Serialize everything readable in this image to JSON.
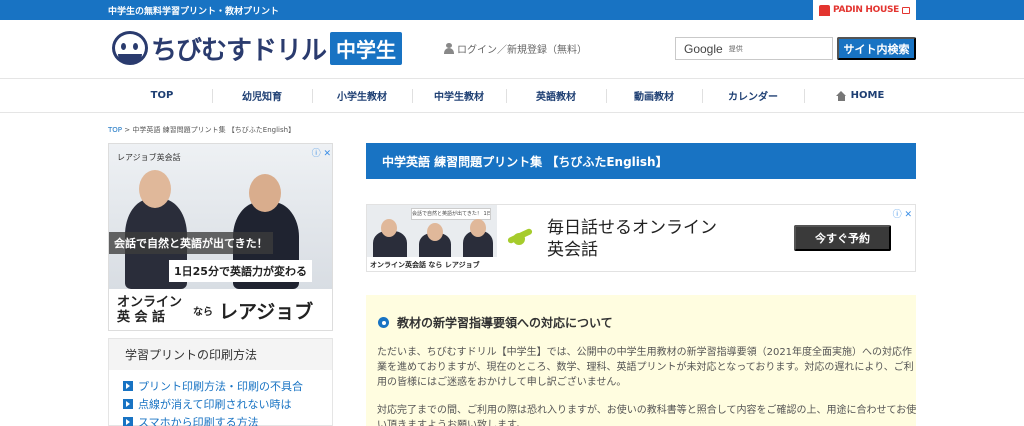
{
  "topbar": {
    "tagline": "中学生の無料学習プリント・教材プリント",
    "partner_logo": "PADIN HOUSE"
  },
  "header": {
    "logo_text": "ちびむすドリル",
    "logo_badge": "中学生",
    "login": "ログイン／新規登録（無料）",
    "search_brand": "Google",
    "search_provider": "提供",
    "search_button": "サイト内検索"
  },
  "nav": {
    "items": [
      "TOP",
      "幼児知育",
      "小学生教材",
      "中学生教材",
      "英語教材",
      "動画教材",
      "カレンダー",
      "HOME"
    ]
  },
  "breadcrumb": {
    "top": "TOP",
    "sep": " > ",
    "rest": "中学英語 練習問題プリント集 【ちびふたEnglish】"
  },
  "side_ad": {
    "brand": "レアジョブ英会話",
    "caption1": "会話で自然と英語が出てきた！",
    "caption2": "1日25分で英語力が変わる",
    "bottom1": "オンライン\n英 会 話",
    "bottom2": "なら",
    "bottom3": "レアジョブ",
    "adchoice": "ⓘ ✕"
  },
  "sidebar": {
    "title": "学習プリントの印刷方法",
    "items": [
      "プリント印刷方法・印刷の不具合",
      "点線が消えて印刷されない時は",
      "スマホから印刷する方法"
    ]
  },
  "main": {
    "page_title": "中学英語 練習問題プリント集 【ちびふたEnglish】"
  },
  "main_ad": {
    "tag": "会話で自然と英語が出てきた！ 1日25分で英語力が変わる",
    "left_footer": "オンライン英会話 なら レアジョブ",
    "headline": "毎日話せるオンライン\n英会話",
    "cta": "今すぐ予約",
    "adchoice": "ⓘ ✕"
  },
  "notice": {
    "heading": "教材の新学習指導要領への対応について",
    "p1": "ただいま、ちびむすドリル【中学生】では、公開中の中学生用教材の新学習指導要領（2021年度全面実施）への対応作業を進めておりますが、現在のところ、数学、理科、英語プリントが未対応となっております。対応の遅れにより、ご利用の皆様にはご迷惑をおかけして申し訳ございません。",
    "p2": "対応完了までの間、ご利用の際は恐れ入りますが、お使いの教科書等と照合して内容をご確認の上、用途に合わせてお使い頂きますようお願い致します。"
  },
  "colors": {
    "brand_blue": "#1873c3",
    "nav_text": "#1e3f73",
    "notice_bg": "#fffde0"
  }
}
